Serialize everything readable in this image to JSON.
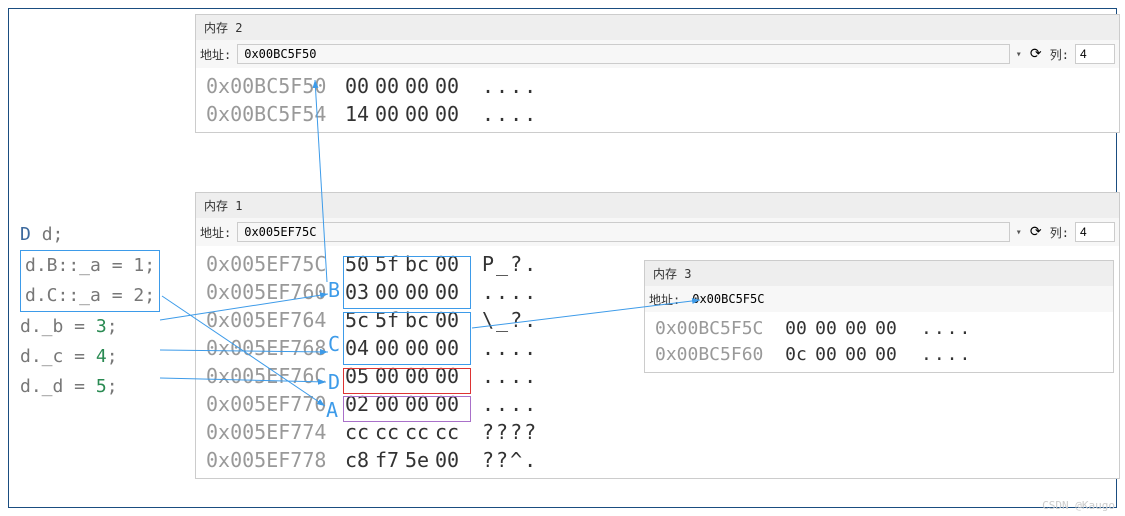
{
  "code": {
    "line1_type": "D",
    "line1_var": "d;",
    "line2": "d.B::_a = 1;",
    "line3": "d.C::_a = 2;",
    "line4_l": "d._b = ",
    "line4_n": "3",
    "line5_l": "d._c = ",
    "line5_n": "4",
    "line6_l": "d._d = ",
    "line6_n": "5"
  },
  "mem2": {
    "title": "内存 2",
    "addr_label": "地址:",
    "address": "0x00BC5F50",
    "col_label": "列:",
    "col_value": "4",
    "rows": [
      {
        "addr": "0x00BC5F50",
        "hex": [
          "00",
          "00",
          "00",
          "00"
        ],
        "ascii": "...."
      },
      {
        "addr": "0x00BC5F54",
        "hex": [
          "14",
          "00",
          "00",
          "00"
        ],
        "ascii": "...."
      }
    ]
  },
  "mem1": {
    "title": "内存 1",
    "addr_label": "地址:",
    "address": "0x005EF75C",
    "col_label": "列:",
    "col_value": "4",
    "rows": [
      {
        "addr": "0x005EF75C",
        "hex": [
          "50",
          "5f",
          "bc",
          "00"
        ],
        "ascii": "P_?."
      },
      {
        "addr": "0x005EF760",
        "hex": [
          "03",
          "00",
          "00",
          "00"
        ],
        "ascii": "...."
      },
      {
        "addr": "0x005EF764",
        "hex": [
          "5c",
          "5f",
          "bc",
          "00"
        ],
        "ascii": "\\_?."
      },
      {
        "addr": "0x005EF768",
        "hex": [
          "04",
          "00",
          "00",
          "00"
        ],
        "ascii": "...."
      },
      {
        "addr": "0x005EF76C",
        "hex": [
          "05",
          "00",
          "00",
          "00"
        ],
        "ascii": "....",
        "red": true
      },
      {
        "addr": "0x005EF770",
        "hex": [
          "02",
          "00",
          "00",
          "00"
        ],
        "ascii": "...."
      },
      {
        "addr": "0x005EF774",
        "hex": [
          "cc",
          "cc",
          "cc",
          "cc"
        ],
        "ascii": "????"
      },
      {
        "addr": "0x005EF778",
        "hex": [
          "c8",
          "f7",
          "5e",
          "00"
        ],
        "ascii": "??^."
      }
    ]
  },
  "mem3": {
    "title": "内存 3",
    "addr_label": "地址:",
    "address": "0x00BC5F5C",
    "rows": [
      {
        "addr": "0x00BC5F5C",
        "hex": [
          "00",
          "00",
          "00",
          "00"
        ],
        "ascii": "...."
      },
      {
        "addr": "0x00BC5F60",
        "hex": [
          "0c",
          "00",
          "00",
          "00"
        ],
        "ascii": "...."
      }
    ]
  },
  "labels": {
    "B": "B",
    "C": "C",
    "D": "D",
    "A": "A"
  },
  "watermark": "CSDN @Kaugo"
}
